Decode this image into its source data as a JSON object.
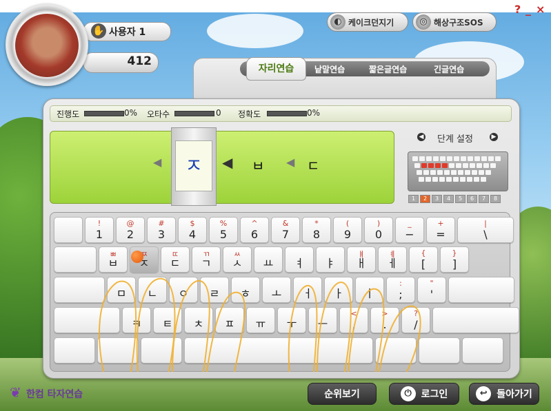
{
  "user": {
    "name": "사용자 1",
    "score": "412",
    "hand_icon": "hand-icon"
  },
  "top_buttons": [
    {
      "label": "케이크던지기",
      "icon": "cake-icon"
    },
    {
      "label": "해상구조SOS",
      "icon": "lifebuoy-icon"
    }
  ],
  "window_controls": {
    "help": "?",
    "minimize": "_",
    "close": "×"
  },
  "tabs": [
    {
      "label": "자리연습",
      "active": true
    },
    {
      "label": "낱말연습"
    },
    {
      "label": "짧은글연습"
    },
    {
      "label": "긴글연습"
    }
  ],
  "stats": {
    "progress_label": "진행도",
    "progress_value": "0%",
    "progress_fraction": 0,
    "typos_label": "오타수",
    "typos_value": "0",
    "typos_fraction": 0,
    "accuracy_label": "정확도",
    "accuracy_value": "0%",
    "accuracy_fraction": 0
  },
  "practice": {
    "current_char": "ㅈ",
    "next_chars": [
      "ㅂ",
      "ㄷ"
    ]
  },
  "level": {
    "label": "단계 설정",
    "numbers": [
      "1",
      "2",
      "3",
      "4",
      "5",
      "6",
      "7",
      "8"
    ],
    "active": "2"
  },
  "keyboard": {
    "row1": [
      {
        "top": "",
        "bot": ""
      },
      {
        "top": "!",
        "bot": "1"
      },
      {
        "top": "@",
        "bot": "2"
      },
      {
        "top": "#",
        "bot": "3"
      },
      {
        "top": "$",
        "bot": "4"
      },
      {
        "top": "%",
        "bot": "5"
      },
      {
        "top": "^",
        "bot": "6"
      },
      {
        "top": "&",
        "bot": "7"
      },
      {
        "top": "*",
        "bot": "8"
      },
      {
        "top": "(",
        "bot": "9"
      },
      {
        "top": ")",
        "bot": "0"
      },
      {
        "top": "_",
        "bot": "−"
      },
      {
        "top": "+",
        "bot": "="
      },
      {
        "top": "|",
        "bot": "\\"
      }
    ],
    "row2": [
      {
        "top": "",
        "bot": ""
      },
      {
        "top": "ㅃ",
        "bot": "ㅂ"
      },
      {
        "top": "ㅉ",
        "bot": "ㅈ"
      },
      {
        "top": "ㄸ",
        "bot": "ㄷ"
      },
      {
        "top": "ㄲ",
        "bot": "ㄱ"
      },
      {
        "top": "ㅆ",
        "bot": "ㅅ"
      },
      {
        "top": "",
        "bot": "ㅛ"
      },
      {
        "top": "",
        "bot": "ㅕ"
      },
      {
        "top": "",
        "bot": "ㅑ"
      },
      {
        "top": "ㅒ",
        "bot": "ㅐ"
      },
      {
        "top": "ㅖ",
        "bot": "ㅔ"
      },
      {
        "top": "{",
        "bot": "["
      },
      {
        "top": "}",
        "bot": "]"
      }
    ],
    "row3": [
      {
        "top": "",
        "bot": ""
      },
      {
        "top": "",
        "bot": "ㅁ"
      },
      {
        "top": "",
        "bot": "ㄴ"
      },
      {
        "top": "",
        "bot": "ㅇ"
      },
      {
        "top": "",
        "bot": "ㄹ"
      },
      {
        "top": "",
        "bot": "ㅎ"
      },
      {
        "top": "",
        "bot": "ㅗ"
      },
      {
        "top": "",
        "bot": "ㅓ"
      },
      {
        "top": "",
        "bot": "ㅏ"
      },
      {
        "top": "",
        "bot": "ㅣ"
      },
      {
        "top": ":",
        "bot": ";"
      },
      {
        "top": "\"",
        "bot": "'"
      },
      {
        "top": "",
        "bot": ""
      }
    ],
    "row4": [
      {
        "top": "",
        "bot": ""
      },
      {
        "top": "",
        "bot": "ㅋ"
      },
      {
        "top": "",
        "bot": "ㅌ"
      },
      {
        "top": "",
        "bot": "ㅊ"
      },
      {
        "top": "",
        "bot": "ㅍ"
      },
      {
        "top": "",
        "bot": "ㅠ"
      },
      {
        "top": "",
        "bot": "ㅜ"
      },
      {
        "top": "",
        "bot": "ㅡ"
      },
      {
        "top": "<",
        "bot": ","
      },
      {
        "top": ">",
        "bot": "."
      },
      {
        "top": "?",
        "bot": "/"
      },
      {
        "top": "",
        "bot": ""
      }
    ],
    "active_key": "ㅈ"
  },
  "brand": {
    "logo_text": "한컴 타자연습"
  },
  "bottom_buttons": [
    {
      "label": "순위보기",
      "icon": ""
    },
    {
      "label": "로그인",
      "icon": "power-icon"
    },
    {
      "label": "돌아가기",
      "icon": "back-arrow-icon"
    }
  ],
  "colors": {
    "tab_active": "#4c7b12",
    "practice_green": "#b6e255",
    "target_char": "#1c3fb5",
    "accent_orange": "#e2662a"
  }
}
